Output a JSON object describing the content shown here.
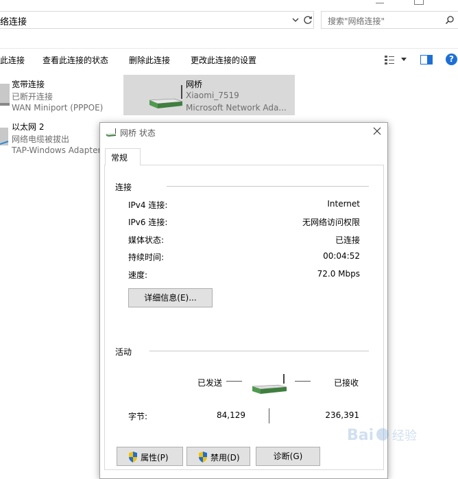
{
  "address": {
    "path": "络连接"
  },
  "search": {
    "placeholder": "搜索\"网络连接\""
  },
  "toolbar": {
    "items": [
      "此连接",
      "查看此连接的状态",
      "删除此连接",
      "更改此连接的设置"
    ]
  },
  "connections": [
    {
      "name": "宽带连接",
      "status": "已断开连接",
      "device": "WAN Miniport (PPPOE)"
    },
    {
      "name": "以太网 2",
      "status": "网络电缆被拔出",
      "device": "TAP-Windows Adapter"
    },
    {
      "name": "网桥",
      "status": "Xiaomi_7519",
      "device": "Microsoft Network Ada..."
    }
  ],
  "dialog": {
    "title": "网桥 状态",
    "tab": "常规",
    "connection_group": "连接",
    "rows": [
      {
        "label": "IPv4 连接:",
        "value": "Internet"
      },
      {
        "label": "IPv6 连接:",
        "value": "无网络访问权限"
      },
      {
        "label": "媒体状态:",
        "value": "已连接"
      },
      {
        "label": "持续时间:",
        "value": "00:04:52"
      },
      {
        "label": "速度:",
        "value": "72.0 Mbps"
      }
    ],
    "details_button": "详细信息(E)...",
    "activity_group": "活动",
    "sent_label": "已发送",
    "received_label": "已接收",
    "bytes_label": "字节:",
    "bytes_sent": "84,129",
    "bytes_received": "236,391",
    "buttons": {
      "properties": "属性(P)",
      "disable": "禁用(D)",
      "diagnose": "诊断(G)"
    }
  },
  "colors": {
    "accent": "#1d6fd6",
    "selected_tile": "#d9d9d9",
    "router_green": "#4f9a4f"
  },
  "icons": [
    "chevron-down-icon",
    "refresh-icon",
    "search-icon",
    "view-options-icon",
    "preview-pane-icon",
    "help-icon",
    "router-icon",
    "close-icon",
    "shield-icon"
  ]
}
